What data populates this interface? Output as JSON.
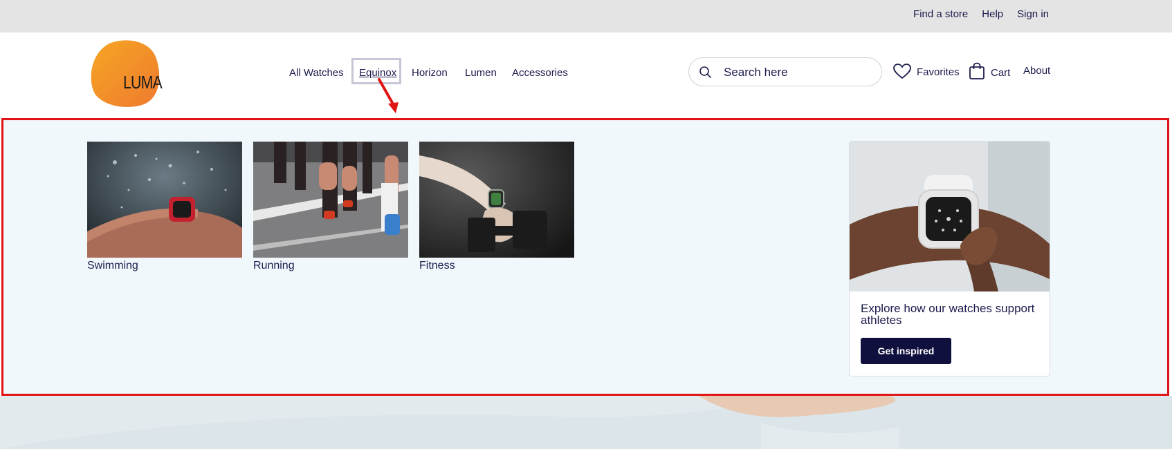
{
  "topbar": {
    "links": [
      "Find a store",
      "Help",
      "Sign in"
    ]
  },
  "logo": {
    "text": "LUMA",
    "color": "#f2892e"
  },
  "nav": {
    "items": [
      "All Watches",
      "Equinox",
      "Horizon",
      "Lumen",
      "Accessories"
    ],
    "active": "Equinox"
  },
  "search": {
    "placeholder": "Search here"
  },
  "utility": {
    "favorites": "Favorites",
    "cart": "Cart",
    "about": "About"
  },
  "megamenu": {
    "categories": [
      {
        "label": "Swimming",
        "icon": "swimming-watch-photo"
      },
      {
        "label": "Running",
        "icon": "running-legs-photo"
      },
      {
        "label": "Fitness",
        "icon": "dumbbell-watch-photo"
      }
    ],
    "promo": {
      "text": "Explore how our watches support athletes",
      "button": "Get inspired"
    }
  },
  "colors": {
    "primary": "#10103f",
    "text": "#1b1b4d",
    "panel_bg": "#f1f8fb",
    "highlight_border": "#e01414",
    "topbar_bg": "#e4e4e4"
  }
}
